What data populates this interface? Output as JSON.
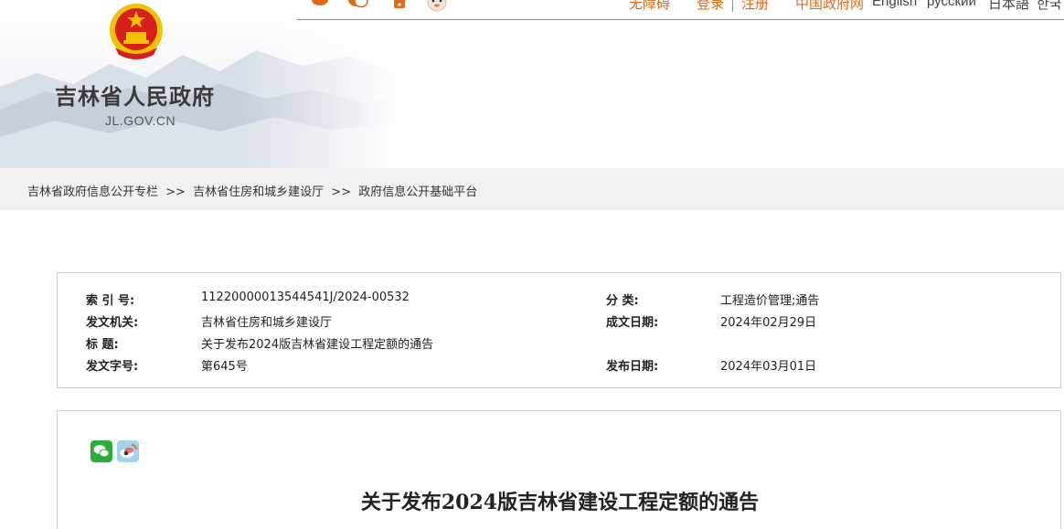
{
  "header": {
    "site_title": "吉林省人民政府",
    "site_domain": "JL.GOV.CN",
    "top_links": {
      "accessibility": "无障碍",
      "login": "登录",
      "register": "注册",
      "china_gov": "中国政府网",
      "english": "English",
      "russian": "русский",
      "japanese": "日本語",
      "korean": "한국"
    },
    "icons": [
      "weibo-icon",
      "wechat-icon",
      "mobile-icon",
      "mascot-icon"
    ]
  },
  "breadcrumb": {
    "items": [
      "吉林省政府信息公开专栏",
      "吉林省住房和城乡建设厅",
      "政府信息公开基础平台"
    ],
    "separator": ">>"
  },
  "meta": {
    "index_label": "索 引 号:",
    "index_value": "11220000013544541J/2024-00532",
    "category_label": "分    类:",
    "category_value": "工程造价管理;通告",
    "issuer_label": "发文机关:",
    "issuer_value": "吉林省住房和城乡建设厅",
    "written_date_label": "成文日期:",
    "written_date_value": "2024年02月29日",
    "title_label": "标      题:",
    "title_value": "关于发布2024版吉林省建设工程定额的通告",
    "doc_no_label": "发文字号:",
    "doc_no_value": "第645号",
    "publish_date_label": "发布日期:",
    "publish_date_value": "2024年03月01日"
  },
  "article": {
    "share_icons": [
      "wechat-share-icon",
      "weibo-share-icon"
    ],
    "title": "关于发布2024版吉林省建设工程定额的通告"
  },
  "colors": {
    "accent": "#e06a1c",
    "emblem_red": "#d7201b",
    "emblem_gold": "#f2c200",
    "crumb_bg": "#f1f1f1"
  }
}
